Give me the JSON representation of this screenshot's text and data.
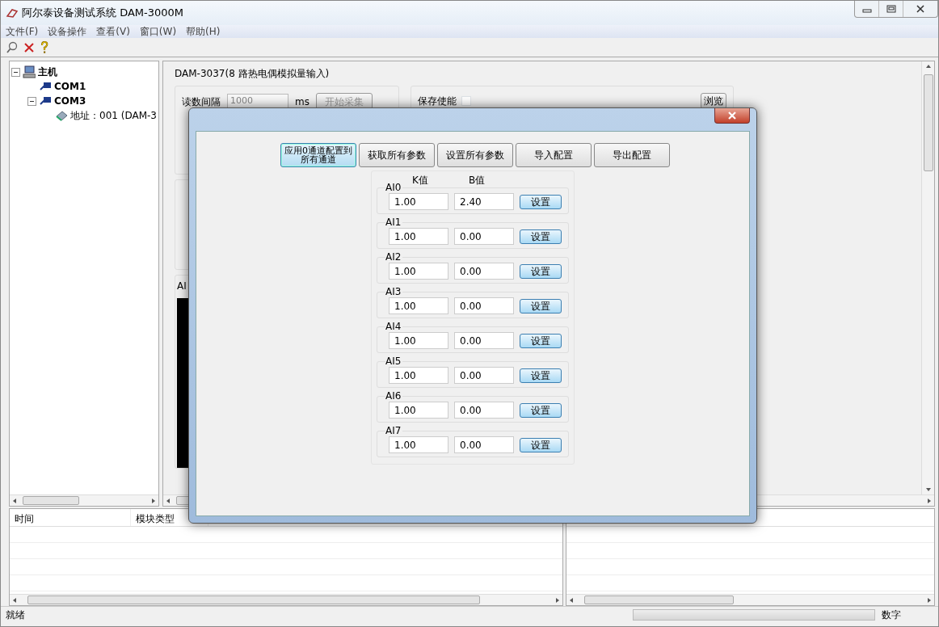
{
  "window": {
    "title": "阿尔泰设备测试系统 DAM-3000M"
  },
  "menu": [
    "文件(F)",
    "设备操作",
    "查看(V)",
    "窗口(W)",
    "帮助(H)"
  ],
  "tree": [
    {
      "label": "主机",
      "kind": "host",
      "expanded": true,
      "children": [
        {
          "label": "COM1",
          "kind": "port"
        },
        {
          "label": "COM3",
          "kind": "port",
          "expanded": true,
          "children": [
            {
              "label": "地址：001 (DAM-3",
              "kind": "module"
            }
          ]
        }
      ]
    }
  ],
  "module": {
    "title": "DAM-3037(8 路热电偶模拟量输入)",
    "interval_label": "读数间隔",
    "interval": "1000",
    "unit": "ms",
    "start_button": "开始采集",
    "start_disabled": true,
    "save_label": "保存使能",
    "save_checked": false,
    "browse_button": "浏览",
    "chart_label": "AI"
  },
  "log": {
    "columns": [
      "时间",
      "模块类型"
    ]
  },
  "dialog": {
    "buttons": [
      {
        "label": "应用0通道配置到所有通道",
        "selected": true
      },
      {
        "label": "获取所有参数",
        "selected": false
      },
      {
        "label": "设置所有参数",
        "selected": false
      },
      {
        "label": "导入配置",
        "selected": false
      },
      {
        "label": "导出配置",
        "selected": false
      }
    ],
    "k_header": "K值",
    "b_header": "B值",
    "channels": [
      {
        "name": "AI0",
        "k": "1.00",
        "b": "2.40",
        "button": "设置"
      },
      {
        "name": "AI1",
        "k": "1.00",
        "b": "0.00",
        "button": "设置"
      },
      {
        "name": "AI2",
        "k": "1.00",
        "b": "0.00",
        "button": "设置"
      },
      {
        "name": "AI3",
        "k": "1.00",
        "b": "0.00",
        "button": "设置"
      },
      {
        "name": "AI4",
        "k": "1.00",
        "b": "0.00",
        "button": "设置"
      },
      {
        "name": "AI5",
        "k": "1.00",
        "b": "0.00",
        "button": "设置"
      },
      {
        "name": "AI6",
        "k": "1.00",
        "b": "0.00",
        "button": "设置"
      },
      {
        "name": "AI7",
        "k": "1.00",
        "b": "0.00",
        "button": "设置"
      }
    ]
  },
  "status_bar": {
    "text": "就绪",
    "mode": "数字"
  }
}
